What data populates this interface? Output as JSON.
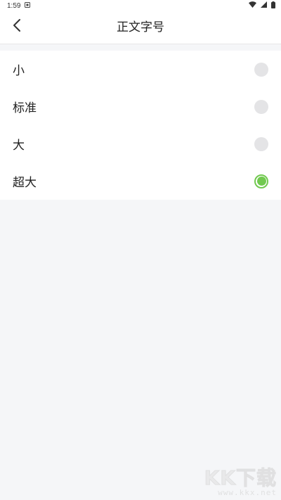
{
  "status_bar": {
    "time": "1:59",
    "icons": [
      "notification-icon",
      "wifi-icon",
      "signal-icon",
      "battery-icon"
    ]
  },
  "header": {
    "title": "正文字号",
    "back_icon": "chevron-left-icon"
  },
  "options": [
    {
      "label": "小",
      "selected": false
    },
    {
      "label": "标准",
      "selected": false
    },
    {
      "label": "大",
      "selected": false
    },
    {
      "label": "超大",
      "selected": true
    }
  ],
  "colors": {
    "accent": "#71c94f",
    "radio_unselected": "#e4e4e6",
    "page_background": "#f5f6f8"
  },
  "watermark": {
    "logo": "KK下载",
    "url": "www.kkx.net"
  }
}
